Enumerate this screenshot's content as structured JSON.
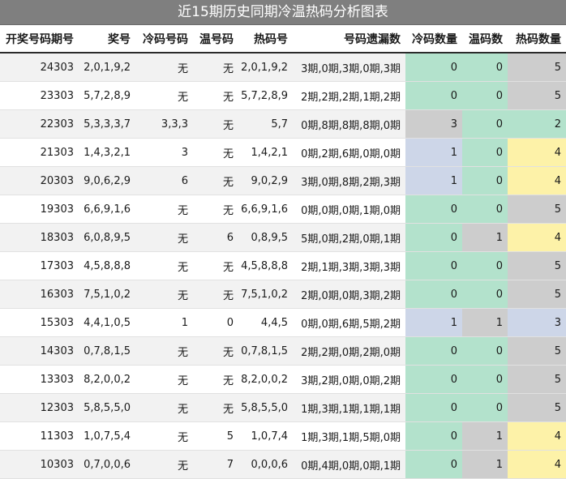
{
  "title": "近15期历史同期冷温热码分析图表",
  "headers": [
    "开奖号码期号",
    "奖号",
    "冷码号码",
    "温号码",
    "热码号",
    "号码遗漏数",
    "冷码数量",
    "温码数",
    "热码数量"
  ],
  "rows": [
    {
      "issue": "24303",
      "numbers": "2,0,1,9,2",
      "cold": "无",
      "warm": "无",
      "hot": "2,0,1,9,2",
      "miss": "3期,0期,3期,0期,3期",
      "cold_count": "0",
      "warm_count": "0",
      "hot_count": "5"
    },
    {
      "issue": "23303",
      "numbers": "5,7,2,8,9",
      "cold": "无",
      "warm": "无",
      "hot": "5,7,2,8,9",
      "miss": "2期,2期,2期,1期,2期",
      "cold_count": "0",
      "warm_count": "0",
      "hot_count": "5"
    },
    {
      "issue": "22303",
      "numbers": "5,3,3,3,7",
      "cold": "3,3,3",
      "warm": "无",
      "hot": "5,7",
      "miss": "0期,8期,8期,8期,0期",
      "cold_count": "3",
      "warm_count": "0",
      "hot_count": "2"
    },
    {
      "issue": "21303",
      "numbers": "1,4,3,2,1",
      "cold": "3",
      "warm": "无",
      "hot": "1,4,2,1",
      "miss": "0期,2期,6期,0期,0期",
      "cold_count": "1",
      "warm_count": "0",
      "hot_count": "4"
    },
    {
      "issue": "20303",
      "numbers": "9,0,6,2,9",
      "cold": "6",
      "warm": "无",
      "hot": "9,0,2,9",
      "miss": "3期,0期,8期,2期,3期",
      "cold_count": "1",
      "warm_count": "0",
      "hot_count": "4"
    },
    {
      "issue": "19303",
      "numbers": "6,6,9,1,6",
      "cold": "无",
      "warm": "无",
      "hot": "6,6,9,1,6",
      "miss": "0期,0期,0期,1期,0期",
      "cold_count": "0",
      "warm_count": "0",
      "hot_count": "5"
    },
    {
      "issue": "18303",
      "numbers": "6,0,8,9,5",
      "cold": "无",
      "warm": "6",
      "hot": "0,8,9,5",
      "miss": "5期,0期,2期,0期,1期",
      "cold_count": "0",
      "warm_count": "1",
      "hot_count": "4"
    },
    {
      "issue": "17303",
      "numbers": "4,5,8,8,8",
      "cold": "无",
      "warm": "无",
      "hot": "4,5,8,8,8",
      "miss": "2期,1期,3期,3期,3期",
      "cold_count": "0",
      "warm_count": "0",
      "hot_count": "5"
    },
    {
      "issue": "16303",
      "numbers": "7,5,1,0,2",
      "cold": "无",
      "warm": "无",
      "hot": "7,5,1,0,2",
      "miss": "2期,0期,0期,3期,2期",
      "cold_count": "0",
      "warm_count": "0",
      "hot_count": "5"
    },
    {
      "issue": "15303",
      "numbers": "4,4,1,0,5",
      "cold": "1",
      "warm": "0",
      "hot": "4,4,5",
      "miss": "0期,0期,6期,5期,2期",
      "cold_count": "1",
      "warm_count": "1",
      "hot_count": "3"
    },
    {
      "issue": "14303",
      "numbers": "0,7,8,1,5",
      "cold": "无",
      "warm": "无",
      "hot": "0,7,8,1,5",
      "miss": "2期,2期,0期,2期,0期",
      "cold_count": "0",
      "warm_count": "0",
      "hot_count": "5"
    },
    {
      "issue": "13303",
      "numbers": "8,2,0,0,2",
      "cold": "无",
      "warm": "无",
      "hot": "8,2,0,0,2",
      "miss": "3期,2期,0期,0期,2期",
      "cold_count": "0",
      "warm_count": "0",
      "hot_count": "5"
    },
    {
      "issue": "12303",
      "numbers": "5,8,5,5,0",
      "cold": "无",
      "warm": "无",
      "hot": "5,8,5,5,0",
      "miss": "1期,3期,1期,1期,1期",
      "cold_count": "0",
      "warm_count": "0",
      "hot_count": "5"
    },
    {
      "issue": "11303",
      "numbers": "1,0,7,5,4",
      "cold": "无",
      "warm": "5",
      "hot": "1,0,7,4",
      "miss": "1期,3期,1期,5期,0期",
      "cold_count": "0",
      "warm_count": "1",
      "hot_count": "4"
    },
    {
      "issue": "10303",
      "numbers": "0,7,0,0,6",
      "cold": "无",
      "warm": "7",
      "hot": "0,0,0,6",
      "miss": "0期,4期,0期,0期,1期",
      "cold_count": "0",
      "warm_count": "1",
      "hot_count": "4"
    }
  ],
  "count_colors": {
    "cold": {
      "0": "#b3e2cc",
      "1": "#cdd6e8",
      "3": "#cdcdcd"
    },
    "warm": {
      "0": "#b3e2cc",
      "1": "#cdcdcd"
    },
    "hot": {
      "2": "#b3e2cc",
      "3": "#cdd6e8",
      "4": "#fdf2a8",
      "5": "#cdcdcd"
    }
  }
}
